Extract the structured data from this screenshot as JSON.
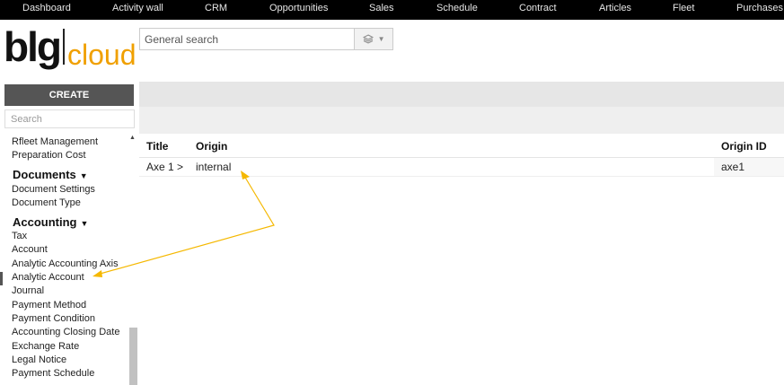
{
  "topnav": {
    "items": [
      "Dashboard",
      "Activity wall",
      "CRM",
      "Opportunities",
      "Sales",
      "Schedule",
      "Contract",
      "Articles",
      "Fleet",
      "Purchases"
    ]
  },
  "logo": {
    "part1": "blg",
    "part2": "cloud"
  },
  "search": {
    "placeholder": "General search",
    "button_icon": "layers-icon"
  },
  "sidebar": {
    "create_label": "CREATE",
    "search_placeholder": "Search",
    "items_top": [
      "Rfleet Management",
      "Preparation Cost"
    ],
    "documents_heading": "Documents",
    "documents_items": [
      "Document Settings",
      "Document Type"
    ],
    "accounting_heading": "Accounting",
    "accounting_items": [
      "Tax",
      "Account",
      "Analytic Accounting Axis",
      "Analytic Account",
      "Journal",
      "Payment Method",
      "Payment Condition",
      "Accounting Closing Date",
      "Exchange Rate",
      "Legal Notice",
      "Payment Schedule"
    ],
    "active_item": "Analytic Account"
  },
  "table": {
    "columns": [
      "Title",
      "Origin",
      "Origin ID"
    ],
    "rows": [
      {
        "title": "Axe 1 >",
        "origin": "internal",
        "origin_id": "axe1"
      }
    ]
  },
  "colors": {
    "nav_bg": "#000000",
    "accent": "#f0a000",
    "annotation_arrow": "#f5b800",
    "create_btn": "#555555"
  }
}
